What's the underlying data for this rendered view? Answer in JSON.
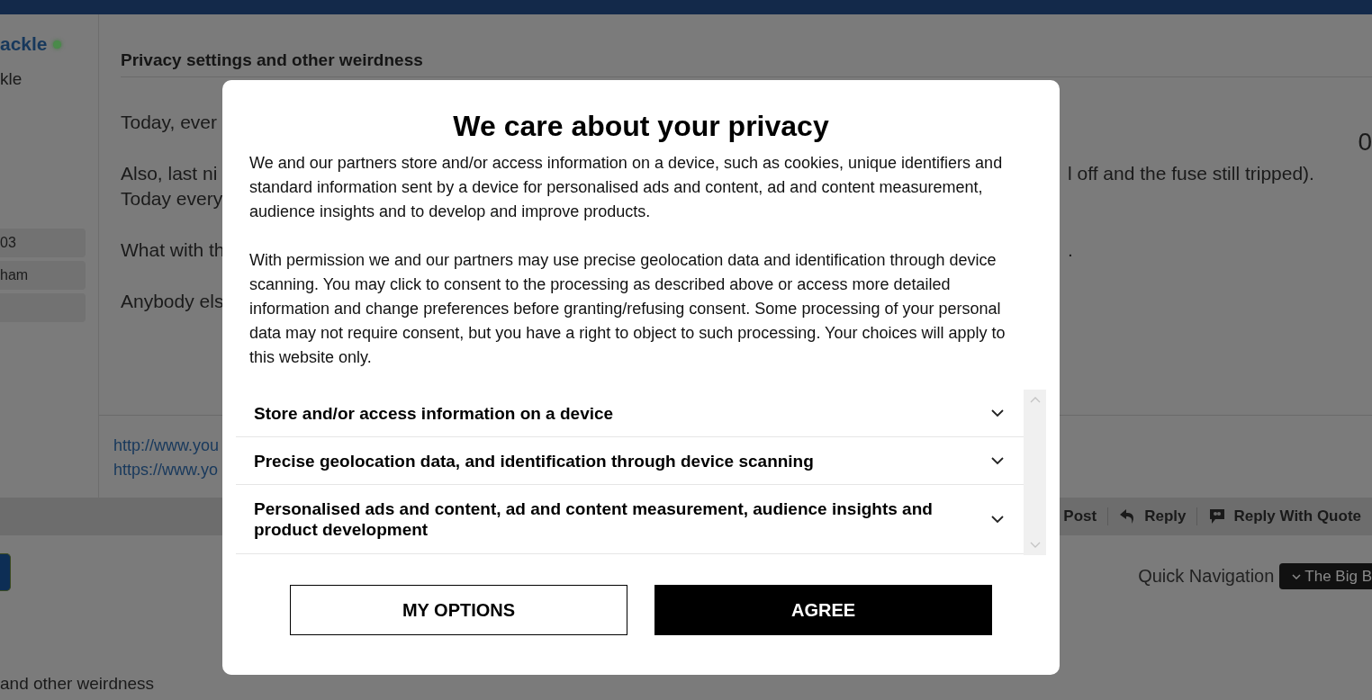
{
  "forum": {
    "user": {
      "name": "ackle",
      "online": true,
      "subtitle": "kle",
      "info_boxes": [
        "03",
        "ham"
      ]
    },
    "post": {
      "title": "Privacy settings and other weirdness",
      "count": "0",
      "paragraphs": [
        {
          "lines": [
            {
              "left": "Today, ever"
            }
          ]
        },
        {
          "lines": [
            {
              "left": "Also, last ni",
              "right": "l off and the fuse still tripped)."
            },
            {
              "left": "Today every"
            }
          ]
        },
        {
          "lines": [
            {
              "left": "What with th",
              "right": "."
            }
          ]
        },
        {
          "lines": [
            {
              "left": "Anybody els"
            }
          ]
        }
      ],
      "signature": [
        "http://www.you",
        "https://www.yo"
      ]
    },
    "actions": [
      {
        "label": "Post",
        "kind": "text"
      },
      {
        "label": "Reply",
        "kind": "reply"
      },
      {
        "label": "Reply With Quote",
        "kind": "quote"
      }
    ],
    "quick_navigation": {
      "label": "Quick Navigation",
      "value": "The Big B"
    },
    "footer_text": "and other weirdness"
  },
  "consent": {
    "title": "We care about your privacy",
    "paragraphs": [
      "We and our partners store and/or access information on a device, such as cookies, unique identifiers and standard information sent by a device for personalised ads and content, ad and content measurement, audience insights and to develop and improve products.",
      "With permission we and our partners may use precise geolocation data and identification through device scanning. You may click to consent to the processing as described above or access more detailed information and change preferences before granting/refusing consent. Some processing of your personal data may not require consent, but you have a right to object to such processing. Your choices will apply to this website only."
    ],
    "purposes": [
      {
        "label": "Store and/or access information on a device",
        "expanded": false
      },
      {
        "label": "Precise geolocation data, and identification through device scanning",
        "expanded": false
      },
      {
        "label": "Personalised ads and content, ad and content measurement, audience insights and product development",
        "expanded": false
      }
    ],
    "buttons": [
      {
        "label": "MY OPTIONS",
        "kind": "outline"
      },
      {
        "label": "AGREE",
        "kind": "solid"
      }
    ]
  }
}
